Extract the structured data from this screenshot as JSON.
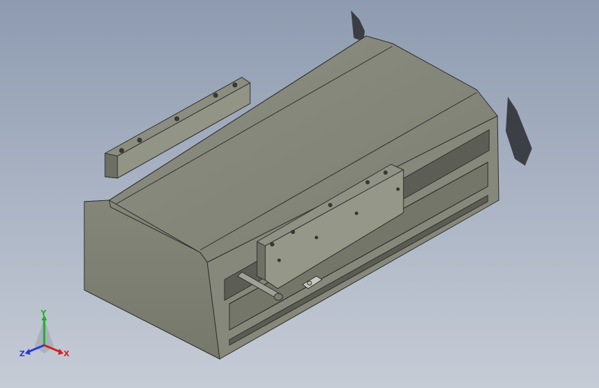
{
  "viewport": {
    "background_top": "#8e9bb0",
    "background_bottom": "#c6ccd6"
  },
  "model": {
    "body_color": "#8a8c7f",
    "end_cap_color": "#7f8173",
    "edge_color": "#2e2f2a"
  },
  "triad": {
    "x_label": "X",
    "y_label": "Y",
    "z_label": "Z",
    "x_color": "#d42020",
    "y_color": "#1fae2a",
    "z_color": "#2a3ad8"
  }
}
